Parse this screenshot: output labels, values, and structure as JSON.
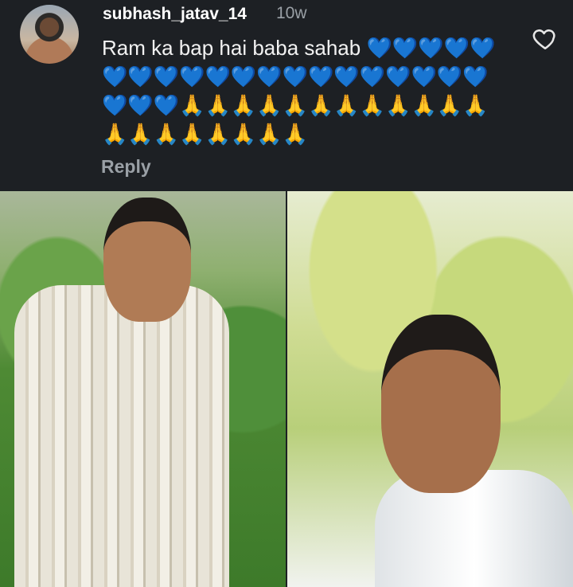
{
  "comment": {
    "username": "subhash_jatav_14",
    "time": "10w",
    "text": "Ram ka bap hai baba sahab 💙💙💙💙💙💙💙💙💙💙💙💙💙💙💙💙💙💙💙💙💙💙💙🙏🙏🙏🙏🙏🙏🙏🙏🙏🙏🙏🙏🙏🙏🙏🙏🙏🙏🙏🙏",
    "reply_label": "Reply",
    "like_icon": "heart-outline-icon"
  },
  "photos": [
    {
      "name": "photo-left"
    },
    {
      "name": "photo-right"
    }
  ],
  "colors": {
    "background": "#1d2024",
    "text": "#ffffff",
    "muted": "#9aa0a6"
  }
}
